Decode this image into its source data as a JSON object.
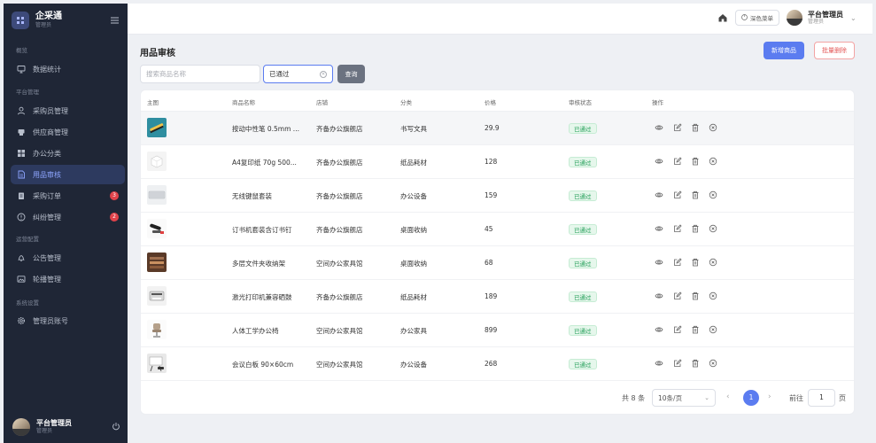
{
  "brand": {
    "name": "企采通",
    "sub": "管理员"
  },
  "sidebar": {
    "groups": [
      {
        "label": "概览"
      },
      {
        "label": "平台管理"
      },
      {
        "label": "运营配置"
      },
      {
        "label": "系统设置"
      }
    ],
    "items": [
      {
        "label": "数据统计",
        "icon": "monitor-icon"
      },
      {
        "label": "采购员管理",
        "icon": "user-icon"
      },
      {
        "label": "供应商管理",
        "icon": "shop-icon"
      },
      {
        "label": "办公分类",
        "icon": "grid-icon"
      },
      {
        "label": "用品审核",
        "icon": "document-icon",
        "active": true
      },
      {
        "label": "采购订单",
        "icon": "clipboard-icon",
        "badge": "3"
      },
      {
        "label": "纠纷管理",
        "icon": "info-circle-icon",
        "badge": "2"
      },
      {
        "label": "公告管理",
        "icon": "bell-icon"
      },
      {
        "label": "轮播管理",
        "icon": "image-icon"
      },
      {
        "label": "管理员账号",
        "icon": "gear-icon"
      }
    ],
    "user": {
      "name": "平台管理员",
      "role": "管理员"
    }
  },
  "topbar": {
    "theme_label": "深色菜单",
    "user": {
      "name": "平台管理员",
      "role": "管理员"
    }
  },
  "page": {
    "title": "用品审核",
    "add_label": "新增商品",
    "batch_delete_label": "批量删除",
    "search_placeholder": "搜索商品名称",
    "status_value": "已通过",
    "query_label": "查询"
  },
  "table": {
    "headers": [
      "主图",
      "商品名称",
      "店铺",
      "分类",
      "价格",
      "审核状态",
      "操作"
    ],
    "rows": [
      {
        "name": "按动中性笔 0.5mm ...",
        "shop": "齐备办公旗舰店",
        "category": "书写文具",
        "price": "29.9",
        "status": "已通过",
        "thumb": "pens"
      },
      {
        "name": "A4复印纸 70g 500...",
        "shop": "齐备办公旗舰店",
        "category": "纸品耗材",
        "price": "128",
        "status": "已通过",
        "thumb": "paper"
      },
      {
        "name": "无线键鼠套装",
        "shop": "齐备办公旗舰店",
        "category": "办公设备",
        "price": "159",
        "status": "已通过",
        "thumb": "keyboard"
      },
      {
        "name": "订书机套装含订书钉",
        "shop": "齐备办公旗舰店",
        "category": "桌面收纳",
        "price": "45",
        "status": "已通过",
        "thumb": "stapler"
      },
      {
        "name": "多层文件夹收纳架",
        "shop": "空间办公家具馆",
        "category": "桌面收纳",
        "price": "68",
        "status": "已通过",
        "thumb": "shelf"
      },
      {
        "name": "激光打印机兼容硒鼓",
        "shop": "齐备办公旗舰店",
        "category": "纸品耗材",
        "price": "189",
        "status": "已通过",
        "thumb": "printer"
      },
      {
        "name": "人体工学办公椅",
        "shop": "空间办公家具馆",
        "category": "办公家具",
        "price": "899",
        "status": "已通过",
        "thumb": "chair"
      },
      {
        "name": "会议白板 90×60cm",
        "shop": "空间办公家具馆",
        "category": "办公设备",
        "price": "268",
        "status": "已通过",
        "thumb": "whiteboard"
      }
    ]
  },
  "pagination": {
    "total": "共 8 条",
    "page_size": "10条/页",
    "current": "1",
    "goto_label": "前往",
    "goto_value": "1",
    "unit": "页"
  },
  "colors": {
    "primary": "#5b7cf0",
    "danger": "#e45a5a",
    "success": "#1f9d55",
    "sidebar": "#1f2636"
  }
}
